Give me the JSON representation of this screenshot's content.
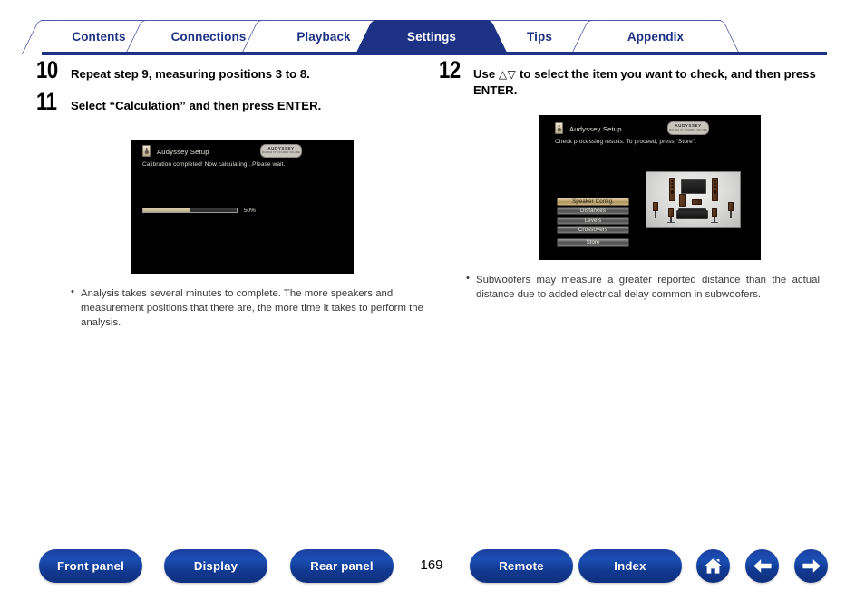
{
  "tabs": [
    {
      "label": "Contents",
      "active": false
    },
    {
      "label": "Connections",
      "active": false
    },
    {
      "label": "Playback",
      "active": false
    },
    {
      "label": "Settings",
      "active": true
    },
    {
      "label": "Tips",
      "active": false
    },
    {
      "label": "Appendix",
      "active": false
    }
  ],
  "left": {
    "step10": {
      "num": "10",
      "text": "Repeat step 9, measuring positions 3 to 8."
    },
    "step11": {
      "num": "11",
      "text": "Select “Calculation” and then press ENTER."
    },
    "osd": {
      "title": "Audyssey Setup",
      "subtitle": "Calibration completed! Now calculating...Please wait.",
      "logo_line1": "AUDYSSEY",
      "logo_line2": "MULTEQ XT  DYNAMIC VOLUME",
      "progress_percent": "50%",
      "progress_value": 50
    },
    "bullet": "Analysis takes several minutes to complete. The more speakers and measurement positions that there are, the more time it takes to perform the analysis."
  },
  "right": {
    "step12": {
      "num": "12",
      "text_before": "Use ",
      "arrows": "△▽",
      "text_after": " to select the item you want to check, and then press ENTER."
    },
    "osd": {
      "title": "Audyssey Setup",
      "subtitle": "Check processing results. To proceed, press “Store”.",
      "logo_line1": "AUDYSSEY",
      "logo_line2": "MULTEQ XT  DYNAMIC VOLUME",
      "menu": [
        {
          "label": "Speaker Config.",
          "selected": true
        },
        {
          "label": "Distances",
          "selected": false
        },
        {
          "label": "Levels",
          "selected": false
        },
        {
          "label": "Crossovers",
          "selected": false
        }
      ],
      "store": "Store"
    },
    "bullet": "Subwoofers may measure a greater reported distance than the actual distance due to added electrical delay common in subwoofers."
  },
  "footer": {
    "buttons": [
      {
        "label": "Front panel"
      },
      {
        "label": "Display"
      },
      {
        "label": "Rear panel"
      },
      {
        "label": "Remote"
      },
      {
        "label": "Index"
      }
    ],
    "page_number": "169",
    "icons": [
      "home-icon",
      "arrow-left-icon",
      "arrow-right-icon"
    ]
  },
  "colors": {
    "accent_navy": "#1d3285",
    "tab_outline": "#4a56a6",
    "pill_blue": "#123a92",
    "osd_background": "#000000",
    "progress_fill": "#c9b88d"
  }
}
